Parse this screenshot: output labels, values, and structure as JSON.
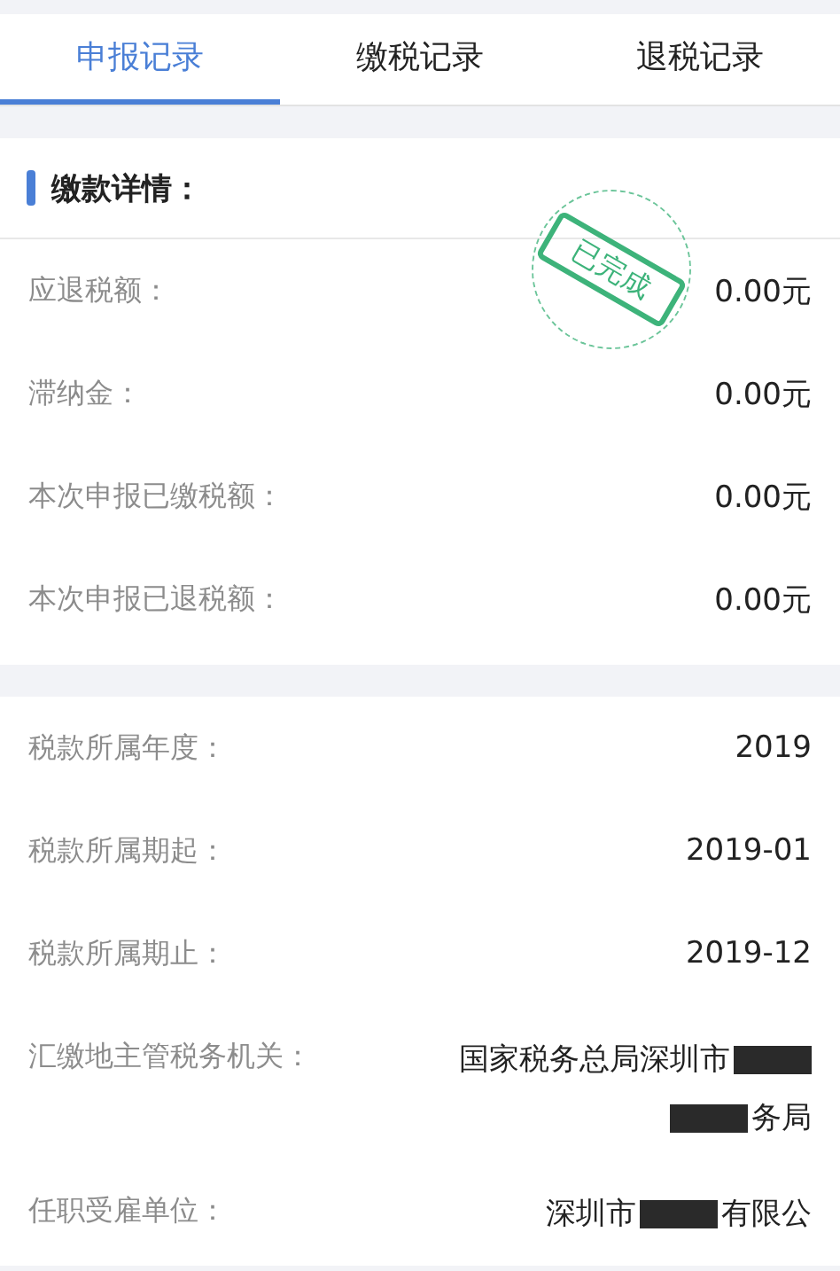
{
  "tabs": [
    {
      "label": "申报记录",
      "selected": true
    },
    {
      "label": "缴税记录",
      "selected": false
    },
    {
      "label": "退税记录",
      "selected": false
    }
  ],
  "payment_section": {
    "title": "缴款详情：",
    "stamp": {
      "text": "已完成"
    },
    "rows": [
      {
        "label": "应退税额：",
        "value": "0.00元"
      },
      {
        "label": "滞纳金：",
        "value": "0.00元"
      },
      {
        "label": "本次申报已缴税额：",
        "value": "0.00元"
      },
      {
        "label": "本次申报已退税额：",
        "value": "0.00元"
      }
    ]
  },
  "tax_section": {
    "rows": [
      {
        "label": "税款所属年度：",
        "value_lines": [
          [
            {
              "kind": "text",
              "text": "2019"
            }
          ]
        ]
      },
      {
        "label": "税款所属期起：",
        "value_lines": [
          [
            {
              "kind": "text",
              "text": "2019-01"
            }
          ]
        ]
      },
      {
        "label": "税款所属期止：",
        "value_lines": [
          [
            {
              "kind": "text",
              "text": "2019-12"
            }
          ]
        ]
      },
      {
        "label": "汇缴地主管税务机关：",
        "value_lines": [
          [
            {
              "kind": "text",
              "text": "国家税务总局深圳市"
            },
            {
              "kind": "redaction"
            }
          ],
          [
            {
              "kind": "redaction"
            },
            {
              "kind": "text",
              "text": "务局"
            }
          ]
        ]
      },
      {
        "label": "任职受雇单位：",
        "value_lines": [
          [
            {
              "kind": "text",
              "text": "深圳市"
            },
            {
              "kind": "redaction"
            },
            {
              "kind": "text",
              "text": "有限公"
            }
          ]
        ]
      }
    ]
  }
}
